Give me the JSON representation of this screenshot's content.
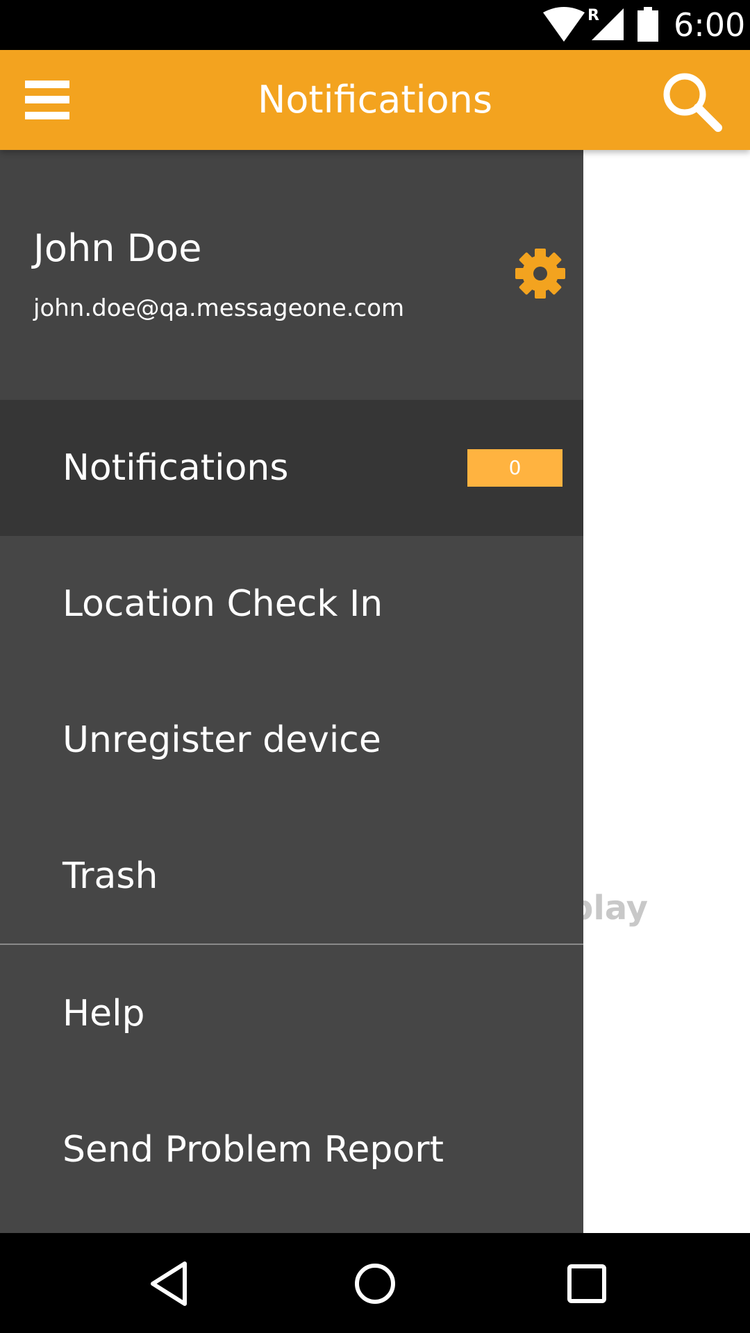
{
  "status_bar": {
    "time": "6:00",
    "roaming_indicator": "R",
    "icons": [
      "wifi-icon",
      "cell-signal-icon",
      "battery-icon"
    ]
  },
  "app_bar": {
    "title": "Notifications",
    "menu_icon": "hamburger-menu-icon",
    "search_icon": "search-icon",
    "color": "#f3a31f"
  },
  "drawer": {
    "user": {
      "name": "John Doe",
      "email": "john.doe@qa.messageone.com"
    },
    "settings_icon": "gear-icon",
    "accent": "#f3a31f",
    "items": [
      {
        "label": "Notifications",
        "badge": "0",
        "selected": true
      },
      {
        "label": "Location Check In"
      },
      {
        "label": "Unregister device"
      },
      {
        "label": "Trash"
      },
      {
        "label": "Help"
      },
      {
        "label": "Send Problem Report"
      }
    ]
  },
  "background": {
    "partial_text": "play"
  },
  "nav_bar": {
    "icons": [
      "back-icon",
      "home-icon",
      "recents-icon"
    ]
  }
}
